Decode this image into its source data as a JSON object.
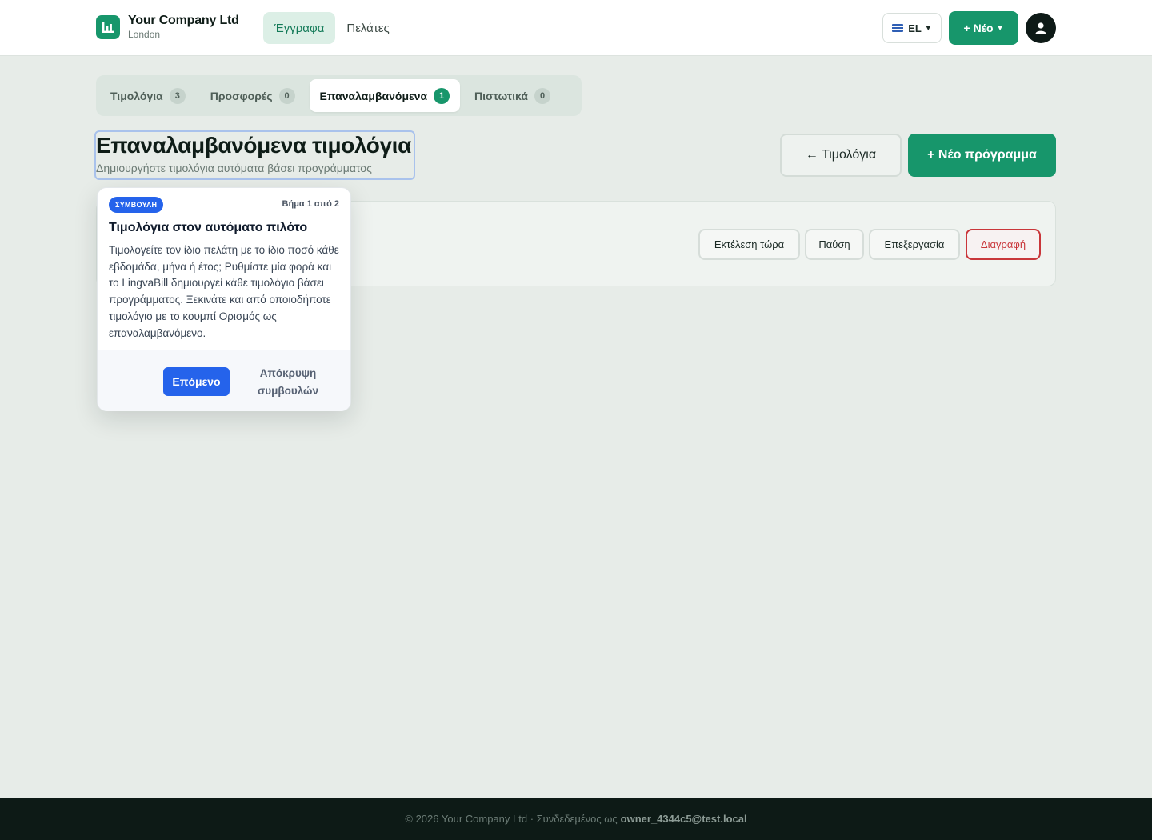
{
  "brand": {
    "name": "Your Company Ltd",
    "city": "London"
  },
  "nav": {
    "documents": "Έγγραφα",
    "clients": "Πελάτες"
  },
  "header": {
    "lang": "EL",
    "new_label": "+ Νέο"
  },
  "tabs": [
    {
      "label": "Τιμολόγια",
      "count": "3"
    },
    {
      "label": "Προσφορές",
      "count": "0"
    },
    {
      "label": "Επαναλαμβανόμενα",
      "count": "1"
    },
    {
      "label": "Πιστωτικά",
      "count": "0"
    }
  ],
  "page": {
    "title": "Επαναλαμβανόμενα τιμολόγια",
    "subtitle": "Δημιουργήστε τιμολόγια αυτόματα βάσει προγράμματος",
    "back_label": "← Τιμολόγια",
    "new_schedule_label": "+ Νέο πρόγραμμα"
  },
  "card": {
    "run_now": "Εκτέλεση τώρα",
    "pause": "Παύση",
    "edit": "Επεξεργασία",
    "delete": "Διαγραφή"
  },
  "tip": {
    "badge": "ΣΥΜΒΟΥΛΗ",
    "step": "Βήμα 1 από 2",
    "title": "Τιμολόγια στον αυτόματο πιλότο",
    "body": "Τιμολογείτε τον ίδιο πελάτη με το ίδιο ποσό κάθε εβδομάδα, μήνα ή έτος; Ρυθμίστε μία φορά και το LingvaBill δημιουργεί κάθε τιμολόγιο βάσει προγράμματος. Ξεκινάτε και από οποιοδήποτε τιμολόγιο με το κουμπί Ορισμός ως επαναλαμβανόμενο.",
    "next": "Επόμενο",
    "hide": "Απόκρυψη συμβουλών"
  },
  "footer": {
    "text": "© 2026 Your Company Ltd · Συνδεδεμένος ως",
    "user": "owner_4344c5@test.local"
  },
  "colors": {
    "accent": "#17966b",
    "tip_blue": "#2563eb",
    "danger": "#c9363a",
    "footer_bg": "#0d1a16"
  }
}
